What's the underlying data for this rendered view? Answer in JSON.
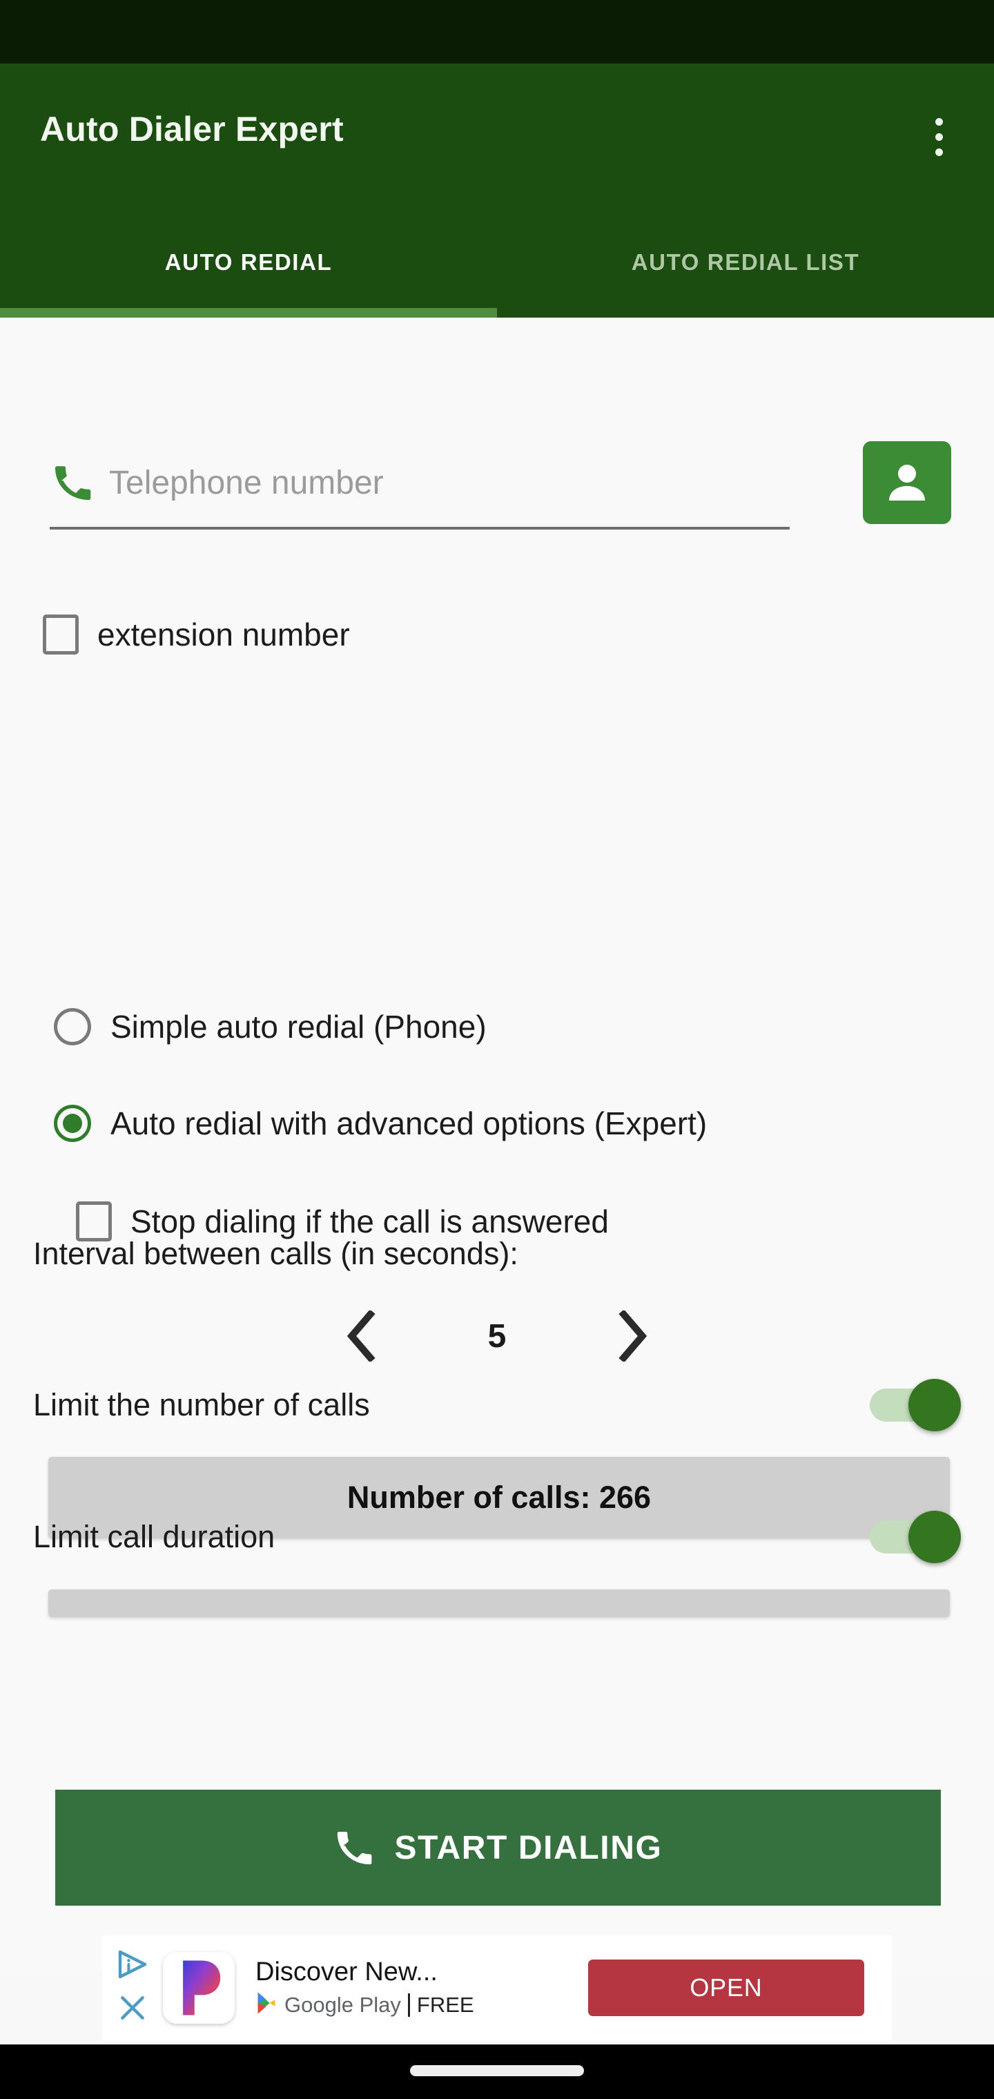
{
  "app": {
    "title": "Auto Dialer Expert",
    "overflow_icon": "more-vert-icon"
  },
  "tabs": [
    {
      "label": "AUTO REDIAL",
      "active": true
    },
    {
      "label": "AUTO REDIAL LIST",
      "active": false
    }
  ],
  "phone": {
    "icon": "phone-icon",
    "placeholder": "Telephone number",
    "value": "",
    "contact_icon": "contact-person-icon"
  },
  "extension": {
    "label": "extension number",
    "checked": false
  },
  "mode": {
    "options": [
      {
        "label": "Simple auto redial (Phone)",
        "selected": false
      },
      {
        "label": "Auto redial with advanced options (Expert)",
        "selected": true
      }
    ]
  },
  "stop_dialing": {
    "label": "Stop dialing if the call is answered",
    "checked": false
  },
  "interval": {
    "label": "Interval between calls (in seconds):",
    "value": "5",
    "decrement_icon": "chevron-left-icon",
    "increment_icon": "chevron-right-icon"
  },
  "limit_calls": {
    "label": "Limit the number of calls",
    "enabled": true,
    "value_bar": "Number of calls:  266"
  },
  "limit_duration": {
    "label": "Limit call duration",
    "enabled": true
  },
  "start": {
    "label": "START DIALING",
    "icon": "phone-icon"
  },
  "ad": {
    "adchoices_icon": "adchoices-icon",
    "close_icon": "close-icon",
    "app_icon": "pandora-p-icon",
    "headline": "Discover New...",
    "store": "Google Play",
    "price": "FREE",
    "cta_label": "OPEN"
  },
  "colors": {
    "status_bar": "#0a1c04",
    "app_bar": "#1b4d10",
    "tab_indicator": "#4f8d3e",
    "accent_green": "#3c8c36",
    "radio_green": "#2f7d2a",
    "switch_thumb": "#33761f",
    "switch_track": "#c3ddbd",
    "start_button": "#35703f",
    "ad_cta": "#b53640",
    "value_bar": "#cfcfcf",
    "page_background": "#f8f9f8"
  }
}
